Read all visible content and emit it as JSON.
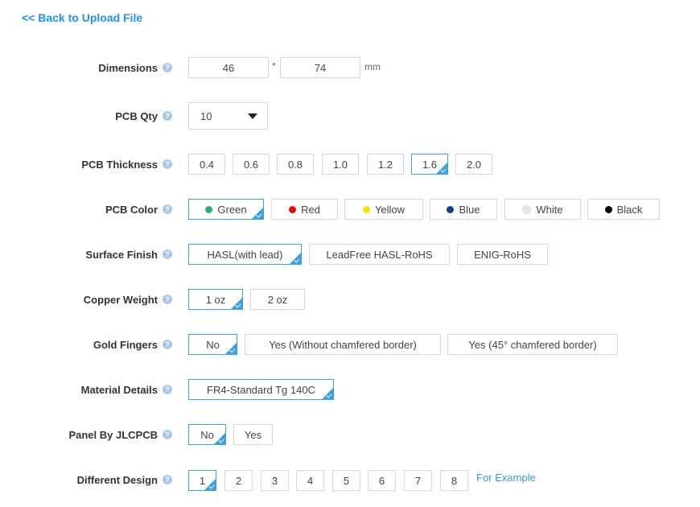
{
  "back_link": "<< Back to Upload File",
  "labels": {
    "dimensions": "Dimensions",
    "pcb_qty": "PCB Qty",
    "pcb_thickness": "PCB Thickness",
    "pcb_color": "PCB Color",
    "surface_finish": "Surface Finish",
    "copper_weight": "Copper Weight",
    "gold_fingers": "Gold Fingers",
    "material_details": "Material Details",
    "panel_by_jlcpcb": "Panel By JLCPCB",
    "different_design": "Different Design"
  },
  "help_glyph": "?",
  "dimensions": {
    "width": "46",
    "height": "74",
    "separator": "*",
    "unit": "mm"
  },
  "pcb_qty": {
    "value": "10"
  },
  "thickness": {
    "options": [
      "0.4",
      "0.6",
      "0.8",
      "1.0",
      "1.2",
      "1.6",
      "2.0"
    ],
    "selected": "1.6"
  },
  "colors": {
    "options": [
      {
        "label": "Green",
        "dot": "#2bb36b"
      },
      {
        "label": "Red",
        "dot": "#e00f0f"
      },
      {
        "label": "Yellow",
        "dot": "#f5e400"
      },
      {
        "label": "Blue",
        "dot": "#0c3e9a"
      },
      {
        "label": "White",
        "dot": "#e6e6e6"
      },
      {
        "label": "Black",
        "dot": "#000000"
      }
    ],
    "selected": "Green"
  },
  "surface_finish": {
    "options": [
      "HASL(with lead)",
      "LeadFree HASL-RoHS",
      "ENIG-RoHS"
    ],
    "selected": "HASL(with lead)"
  },
  "copper_weight": {
    "options": [
      "1 oz",
      "2 oz"
    ],
    "selected": "1 oz"
  },
  "gold_fingers": {
    "options": [
      "No",
      "Yes (Without chamfered border)",
      "Yes (45° chamfered border)"
    ],
    "selected": "No"
  },
  "material": {
    "options": [
      "FR4-Standard Tg 140C"
    ],
    "selected": "FR4-Standard Tg 140C"
  },
  "panel": {
    "options": [
      "No",
      "Yes"
    ],
    "selected": "No"
  },
  "different_design": {
    "options": [
      "1",
      "2",
      "3",
      "4",
      "5",
      "6",
      "7",
      "8"
    ],
    "selected": "1",
    "example_link": "For Example"
  },
  "colors_theme": {
    "accent": "#3aa0e8",
    "link": "#1e90ff"
  }
}
